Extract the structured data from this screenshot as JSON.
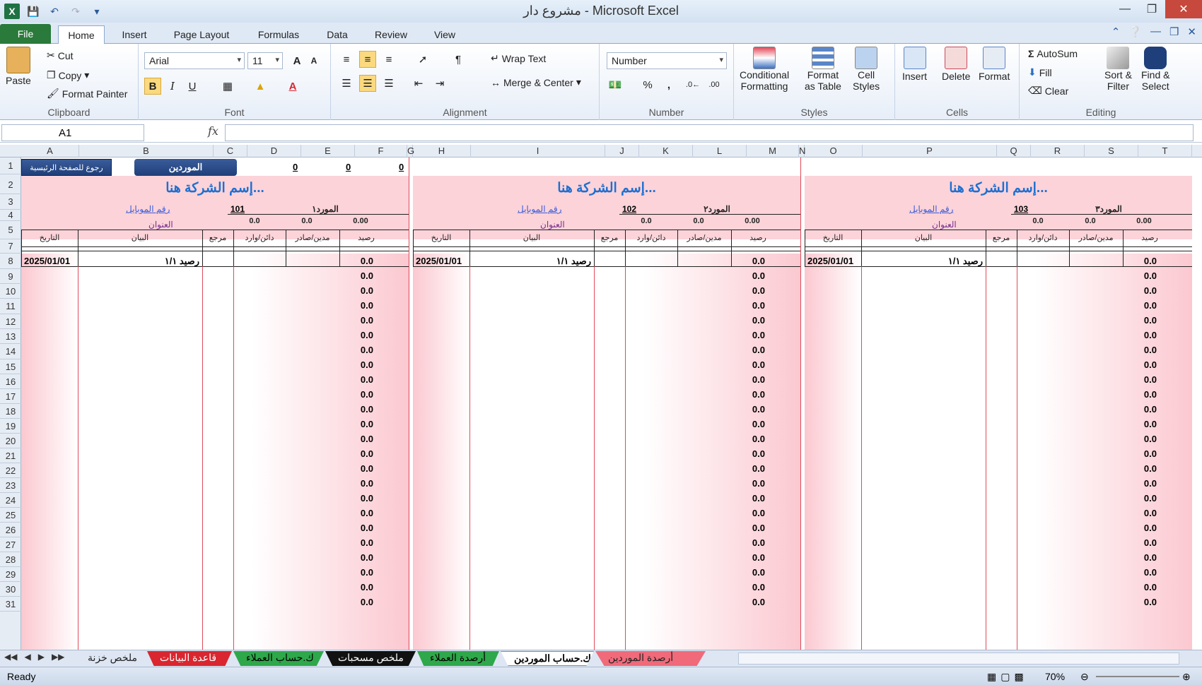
{
  "window": {
    "title": "مشروع دار - Microsoft Excel"
  },
  "tabs": [
    "File",
    "Home",
    "Insert",
    "Page Layout",
    "Formulas",
    "Data",
    "Review",
    "View"
  ],
  "ribbon": {
    "clipboard": {
      "paste": "Paste",
      "cut": "Cut",
      "copy": "Copy",
      "format_painter": "Format Painter",
      "label": "Clipboard"
    },
    "font": {
      "name": "Arial",
      "size": "11",
      "label": "Font",
      "bold": "B",
      "italic": "I",
      "underline": "U"
    },
    "alignment": {
      "wrap": "Wrap Text",
      "merge": "Merge & Center",
      "label": "Alignment"
    },
    "number": {
      "format": "Number",
      "label": "Number",
      "percent": "%",
      "comma": ","
    },
    "styles": {
      "cond": "Conditional",
      "cond2": "Formatting",
      "table": "Format",
      "table2": "as Table",
      "cell": "Cell",
      "cell2": "Styles",
      "label": "Styles"
    },
    "cells": {
      "insert": "Insert",
      "delete": "Delete",
      "format": "Format",
      "label": "Cells"
    },
    "editing": {
      "autosum": "AutoSum",
      "fill": "Fill",
      "clear": "Clear",
      "sort": "Sort &",
      "sort2": "Filter",
      "find": "Find &",
      "find2": "Select",
      "label": "Editing"
    }
  },
  "namebox": "A1",
  "fx": "fx",
  "columns": [
    "A",
    "B",
    "C",
    "D",
    "E",
    "F",
    "G",
    "H",
    "I",
    "J",
    "K",
    "L",
    "M",
    "N",
    "O",
    "P",
    "Q",
    "R",
    "S",
    "T"
  ],
  "rows": [
    "1",
    "2",
    "3",
    "4",
    "5",
    "7",
    "8",
    "9",
    "10",
    "11",
    "12",
    "13",
    "14",
    "15",
    "16",
    "17",
    "18",
    "19",
    "20",
    "21",
    "22",
    "23",
    "24",
    "25",
    "26",
    "27",
    "28",
    "29",
    "30",
    "31"
  ],
  "sheet": {
    "btn_home": "رجوع للصفحة الرئيسية",
    "btn_suppliers": "الموردين",
    "row1_values": [
      "0",
      "0",
      "0"
    ],
    "zero": "0.0",
    "zero2": "0.00",
    "start_date": "2025/01/01",
    "opening": "رصيد ١/١",
    "headers": {
      "date": "التاريخ",
      "desc": "البيان",
      "ref": "مرجع",
      "credit": "دائن/وارد",
      "debit": "مدين/صادر",
      "balance": "رصيد"
    },
    "blocks": [
      {
        "company": "إسم الشركة هنا...",
        "supplier": "المورد١",
        "code": "101",
        "mobile": "رقم الموبايل",
        "address": "العنوان"
      },
      {
        "company": "إسم الشركة هنا...",
        "supplier": "المورد٢",
        "code": "102",
        "mobile": "رقم الموبايل",
        "address": "العنوان"
      },
      {
        "company": "إسم الشركة هنا...",
        "supplier": "المورد٣",
        "code": "103",
        "mobile": "رقم الموبايل",
        "address": "العنوان"
      }
    ]
  },
  "sheet_tabs": [
    {
      "label": "ملخص خزنة",
      "color": "#dde6f2",
      "text": "#222"
    },
    {
      "label": "قاعدة البيانات",
      "color": "#d9262f",
      "text": "#fff"
    },
    {
      "label": "ك.حساب العملاء",
      "color": "#2ea84a",
      "text": "#000"
    },
    {
      "label": "ملخص مسحبات",
      "color": "#111",
      "text": "#fff"
    },
    {
      "label": "أرصدة العملاء",
      "color": "#2ea84a",
      "text": "#000"
    },
    {
      "label": "ك.حساب الموردين",
      "color": "#fff",
      "text": "#000"
    },
    {
      "label": "أرصدة الموردين",
      "color": "#f06a7a",
      "text": "#222"
    }
  ],
  "status": {
    "ready": "Ready",
    "zoom": "70%"
  }
}
